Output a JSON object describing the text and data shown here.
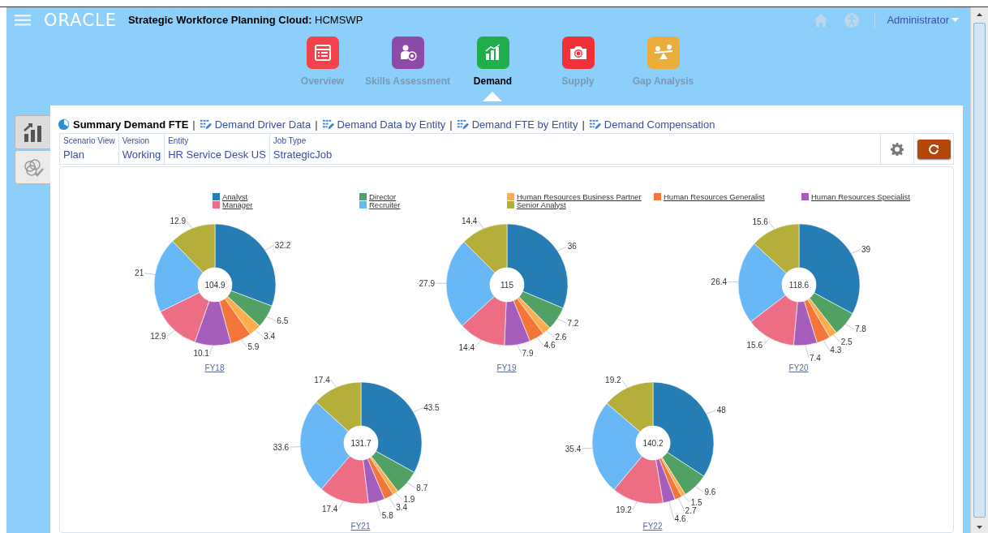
{
  "header": {
    "logo": "ORACLE",
    "title": "**Strategic Workforce Planning Cloud:** HCMSWP",
    "user": "Administrator"
  },
  "nav": [
    {
      "label": "Overview",
      "kind": "list",
      "color": "#f2434a",
      "selected": false
    },
    {
      "label": "Skills Assessment",
      "kind": "person",
      "color": "#8e4aa8",
      "selected": false
    },
    {
      "label": "Demand",
      "kind": "chart",
      "color": "#1fae4a",
      "selected": true
    },
    {
      "label": "Supply",
      "kind": "camera",
      "color": "#f23038",
      "selected": false
    },
    {
      "label": "Gap Analysis",
      "kind": "scale",
      "color": "#eaad3c",
      "selected": false
    }
  ],
  "side_tabs": [
    {
      "kind": "chart",
      "selected": true
    },
    {
      "kind": "check",
      "selected": false
    }
  ],
  "links": [
    {
      "label": "Summary Demand FTE",
      "kind": "chart",
      "selected": true
    },
    {
      "separator": "|",
      "label": "Demand Driver Data",
      "kind": "form",
      "selected": false
    },
    {
      "separator": "|",
      "label": "Demand Data by Entity",
      "kind": "form",
      "selected": false
    },
    {
      "separator": "|",
      "label": "Demand FTE by Entity",
      "kind": "form",
      "selected": false
    },
    {
      "separator": "|",
      "label": "Demand Compensation",
      "kind": "form",
      "selected": false
    }
  ],
  "pov": [
    {
      "label": "Scenario View",
      "value": "Plan"
    },
    {
      "label": "Version",
      "value": "Working"
    },
    {
      "label": "Entity",
      "value": "HR Service Desk US"
    },
    {
      "label": "Job Type",
      "value": "StrategicJob"
    }
  ],
  "legend": [
    {
      "name": "Analyst",
      "color": "#267db3"
    },
    {
      "name": "Director",
      "color": "#50a163"
    },
    {
      "name": "Human Resources Business Partner",
      "color": "#fdad4b"
    },
    {
      "name": "Human Resources Generalist",
      "color": "#f37539"
    },
    {
      "name": "Human Resources Specialist",
      "color": "#a65ebd"
    },
    {
      "name": "Manager",
      "color": "#ed6d85"
    },
    {
      "name": "Recruiter",
      "color": "#68b8f8"
    },
    {
      "name": "Senior Analyst",
      "color": "#b5ae3a"
    }
  ],
  "charts": [
    {
      "total": "104.9",
      "chart_data": {
        "type": "donut",
        "title": "FY18",
        "values": [
          32.2,
          6.5,
          3.4,
          5.9,
          10.1,
          12.9,
          21,
          12.9
        ],
        "data_labels": true
      }
    },
    {
      "total": "115",
      "chart_data": {
        "type": "donut",
        "title": "FY19",
        "values": [
          36,
          7.2,
          2.6,
          4.6,
          7.9,
          14.4,
          27.9,
          14.4
        ],
        "data_labels": true
      }
    },
    {
      "total": "118.6",
      "chart_data": {
        "type": "donut",
        "title": "FY20",
        "values": [
          39,
          7.8,
          2.5,
          4.3,
          7.4,
          15.6,
          26.4,
          15.6
        ],
        "data_labels": true
      }
    },
    {
      "total": "131.7",
      "chart_data": {
        "type": "donut",
        "title": "FY21",
        "values": [
          43.5,
          8.7,
          1.9,
          3.4,
          5.8,
          17.4,
          33.6,
          17.4
        ],
        "data_labels": true
      }
    },
    {
      "total": "140.2",
      "chart_data": {
        "type": "donut",
        "title": "FY22",
        "values": [
          48,
          9.6,
          1.5,
          2.7,
          4.6,
          19.2,
          35.4,
          19.2
        ],
        "data_labels": true
      }
    }
  ]
}
